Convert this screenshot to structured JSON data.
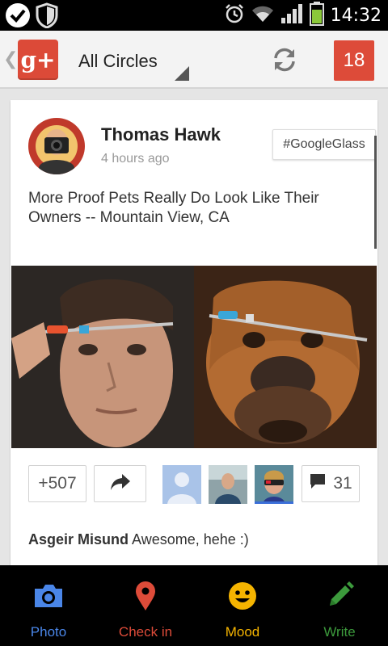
{
  "status_bar": {
    "time": "14:32"
  },
  "action_bar": {
    "app_logo": "g+",
    "circle_filter": "All Circles",
    "notification_count": "18"
  },
  "post": {
    "author": "Thomas Hawk",
    "time_ago": "4 hours ago",
    "hashtag": "#GoogleGlass",
    "text": "More Proof Pets Really Do Look Like Their Owners -- Mountain View, CA",
    "plus_ones": "+507",
    "comment_count": "31",
    "first_comment": {
      "author": "Asgeir Misund",
      "text": "Awesome, hehe :)"
    }
  },
  "bottom_bar": {
    "items": [
      {
        "label": "Photo",
        "color": "#4a86e8",
        "icon": "camera-icon"
      },
      {
        "label": "Check in",
        "color": "#dd4b39",
        "icon": "map-pin-icon"
      },
      {
        "label": "Mood",
        "color": "#f5b400",
        "icon": "smiley-icon"
      },
      {
        "label": "Write",
        "color": "#3c9a3c",
        "icon": "pencil-icon"
      }
    ]
  }
}
